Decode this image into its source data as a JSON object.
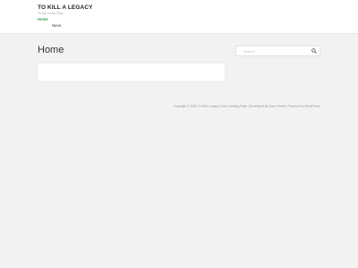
{
  "site": {
    "title": "TO KILL A LEGACY",
    "tagline": "To Kill Looks Stay..."
  },
  "nav": {
    "items": [
      {
        "label": "Home",
        "active": true
      },
      {
        "label": "News",
        "active": false
      }
    ]
  },
  "main": {
    "page_title": "Home"
  },
  "sidebar": {
    "search": {
      "placeholder": "Search ...",
      "icon": "search-icon"
    }
  },
  "footer": {
    "text": "Copyright © 2022 To Kill A Legacy. Book Landing Page | Developed By Rara Theme. Powered by WordPress."
  },
  "colors": {
    "accent": "#3aa35a",
    "background": "#f2f2f2",
    "header_bg": "#ffffff"
  }
}
